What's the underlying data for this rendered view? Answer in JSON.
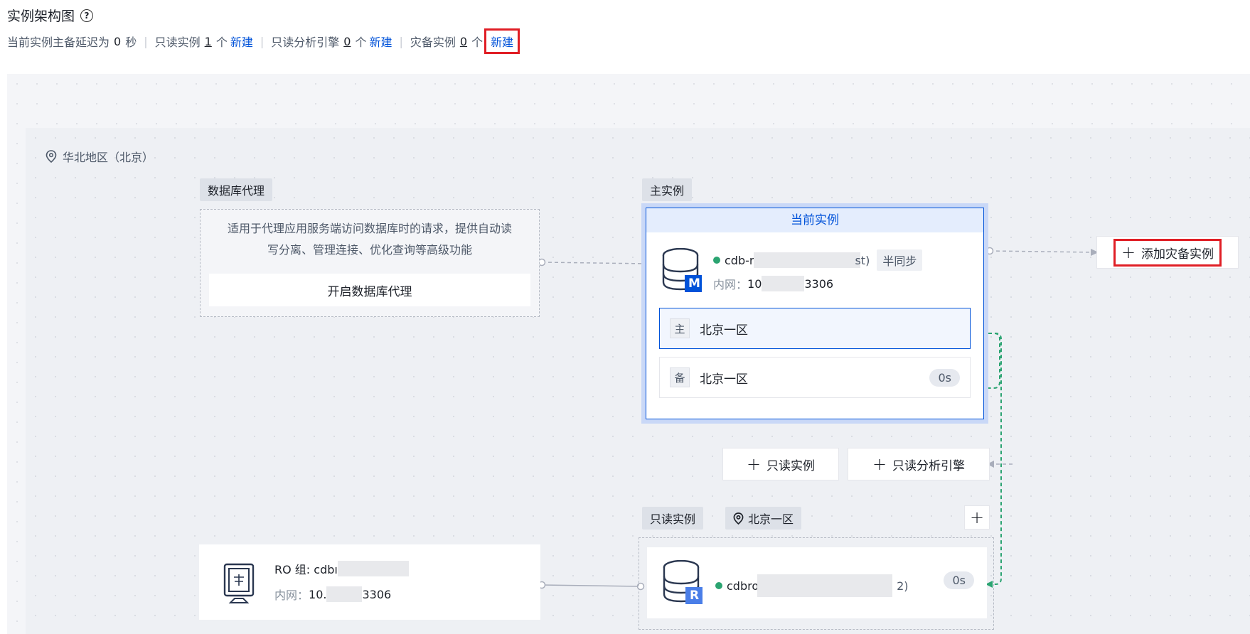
{
  "header": {
    "title": "实例架构图",
    "help_icon": "?",
    "summary": {
      "delay_prefix": "当前实例主备延迟为",
      "delay_value": "0",
      "delay_unit": "秒",
      "readonly_label": "只读实例",
      "readonly_count": "1",
      "readonly_unit": "个",
      "readonly_new": "新建",
      "analysis_label": "只读分析引擎",
      "analysis_count": "0",
      "analysis_unit": "个",
      "analysis_new": "新建",
      "dr_label": "灾备实例",
      "dr_count": "0",
      "dr_unit": "个",
      "dr_new": "新建"
    }
  },
  "region": {
    "label": "华北地区（北京）"
  },
  "proxy": {
    "tag": "数据库代理",
    "description_line1": "适用于代理应用服务端访问数据库时的请求，提供自动读",
    "description_line2": "写分离、管理连接、优化查询等高级功能",
    "button": "开启数据库代理"
  },
  "master": {
    "tag": "主实例",
    "header": "当前实例",
    "icon_letter": "M",
    "id_prefix": "cdb-r",
    "id_suffix": "st)",
    "sync_badge": "半同步",
    "net_label": "内网：",
    "net_prefix": "10",
    "net_suffix": "3306",
    "primary_zone_tag": "主",
    "primary_zone": "北京一区",
    "standby_zone_tag": "备",
    "standby_zone": "北京一区",
    "standby_delay": "0s"
  },
  "add_dr": {
    "label": "添加灾备实例"
  },
  "buttons": {
    "add_readonly": "只读实例",
    "add_analysis": "只读分析引擎"
  },
  "readonly": {
    "tag": "只读实例",
    "zone": "北京一区",
    "add": "+",
    "group_label": "RO 组: cdbı",
    "group_net_label": "内网：",
    "group_net_prefix": "10.",
    "group_net_suffix": "3306",
    "icon_letter": "R",
    "id_prefix": "cdbro",
    "id_suffix": "2)",
    "delay": "0s"
  },
  "colors": {
    "brand": "#0052d9",
    "status_ok": "#2ba471",
    "highlight_border": "#e01e25"
  }
}
